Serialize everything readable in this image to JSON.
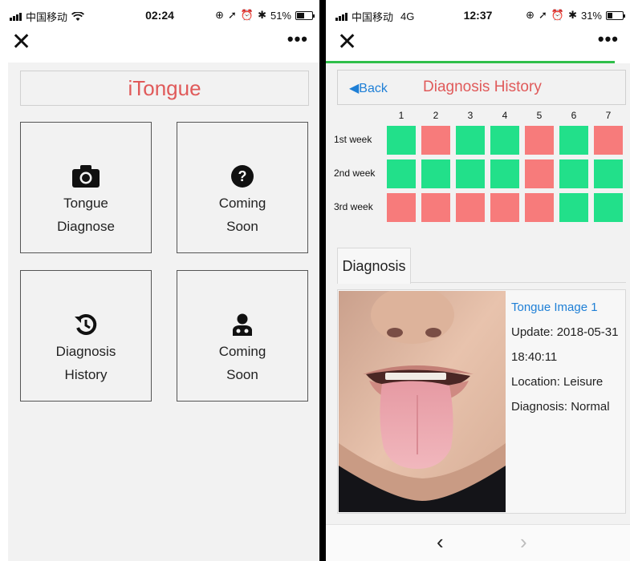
{
  "left_phone": {
    "status": {
      "carrier": "中国移动",
      "time": "02:24",
      "battery_text": "51%",
      "battery_level": 0.51
    },
    "nav": {
      "close_icon": "✕",
      "more_icon": "•••"
    },
    "app_title": "iTongue",
    "tiles": [
      {
        "icon": "camera-icon",
        "line1": "Tongue",
        "line2": "Diagnose"
      },
      {
        "icon": "question-icon",
        "line1": "Coming",
        "line2": "Soon"
      },
      {
        "icon": "history-icon",
        "line1": "Diagnosis",
        "line2": "History"
      },
      {
        "icon": "doctor-icon",
        "line1": "Coming",
        "line2": "Soon"
      }
    ]
  },
  "right_phone": {
    "status": {
      "carrier": "中国移动",
      "network": "4G",
      "time": "12:37",
      "battery_text": "31%",
      "battery_level": 0.31
    },
    "nav": {
      "close_icon": "✕",
      "more_icon": "•••"
    },
    "header": {
      "back_label": "◀Back",
      "title": "Diagnosis History"
    },
    "days": [
      "1",
      "2",
      "3",
      "4",
      "5",
      "6",
      "7"
    ],
    "weeks": [
      {
        "label": "1st week",
        "status": [
          "good",
          "bad",
          "good",
          "good",
          "bad",
          "good",
          "bad"
        ]
      },
      {
        "label": "2nd week",
        "status": [
          "good",
          "good",
          "good",
          "good",
          "bad",
          "good",
          "good"
        ]
      },
      {
        "label": "3rd week",
        "status": [
          "bad",
          "bad",
          "bad",
          "bad",
          "bad",
          "good",
          "good"
        ]
      }
    ],
    "colors": {
      "good": "#22e08a",
      "bad": "#f77b7b"
    },
    "tab_label": "Diagnosis",
    "card": {
      "image_title": "Tongue Image 1",
      "update": "Update: 2018-05-31",
      "time": "18:40:11",
      "location": "Location: Leisure",
      "diagnosis": "Diagnosis: Normal"
    },
    "bottom_nav": {
      "back": "‹",
      "forward": "›"
    }
  }
}
